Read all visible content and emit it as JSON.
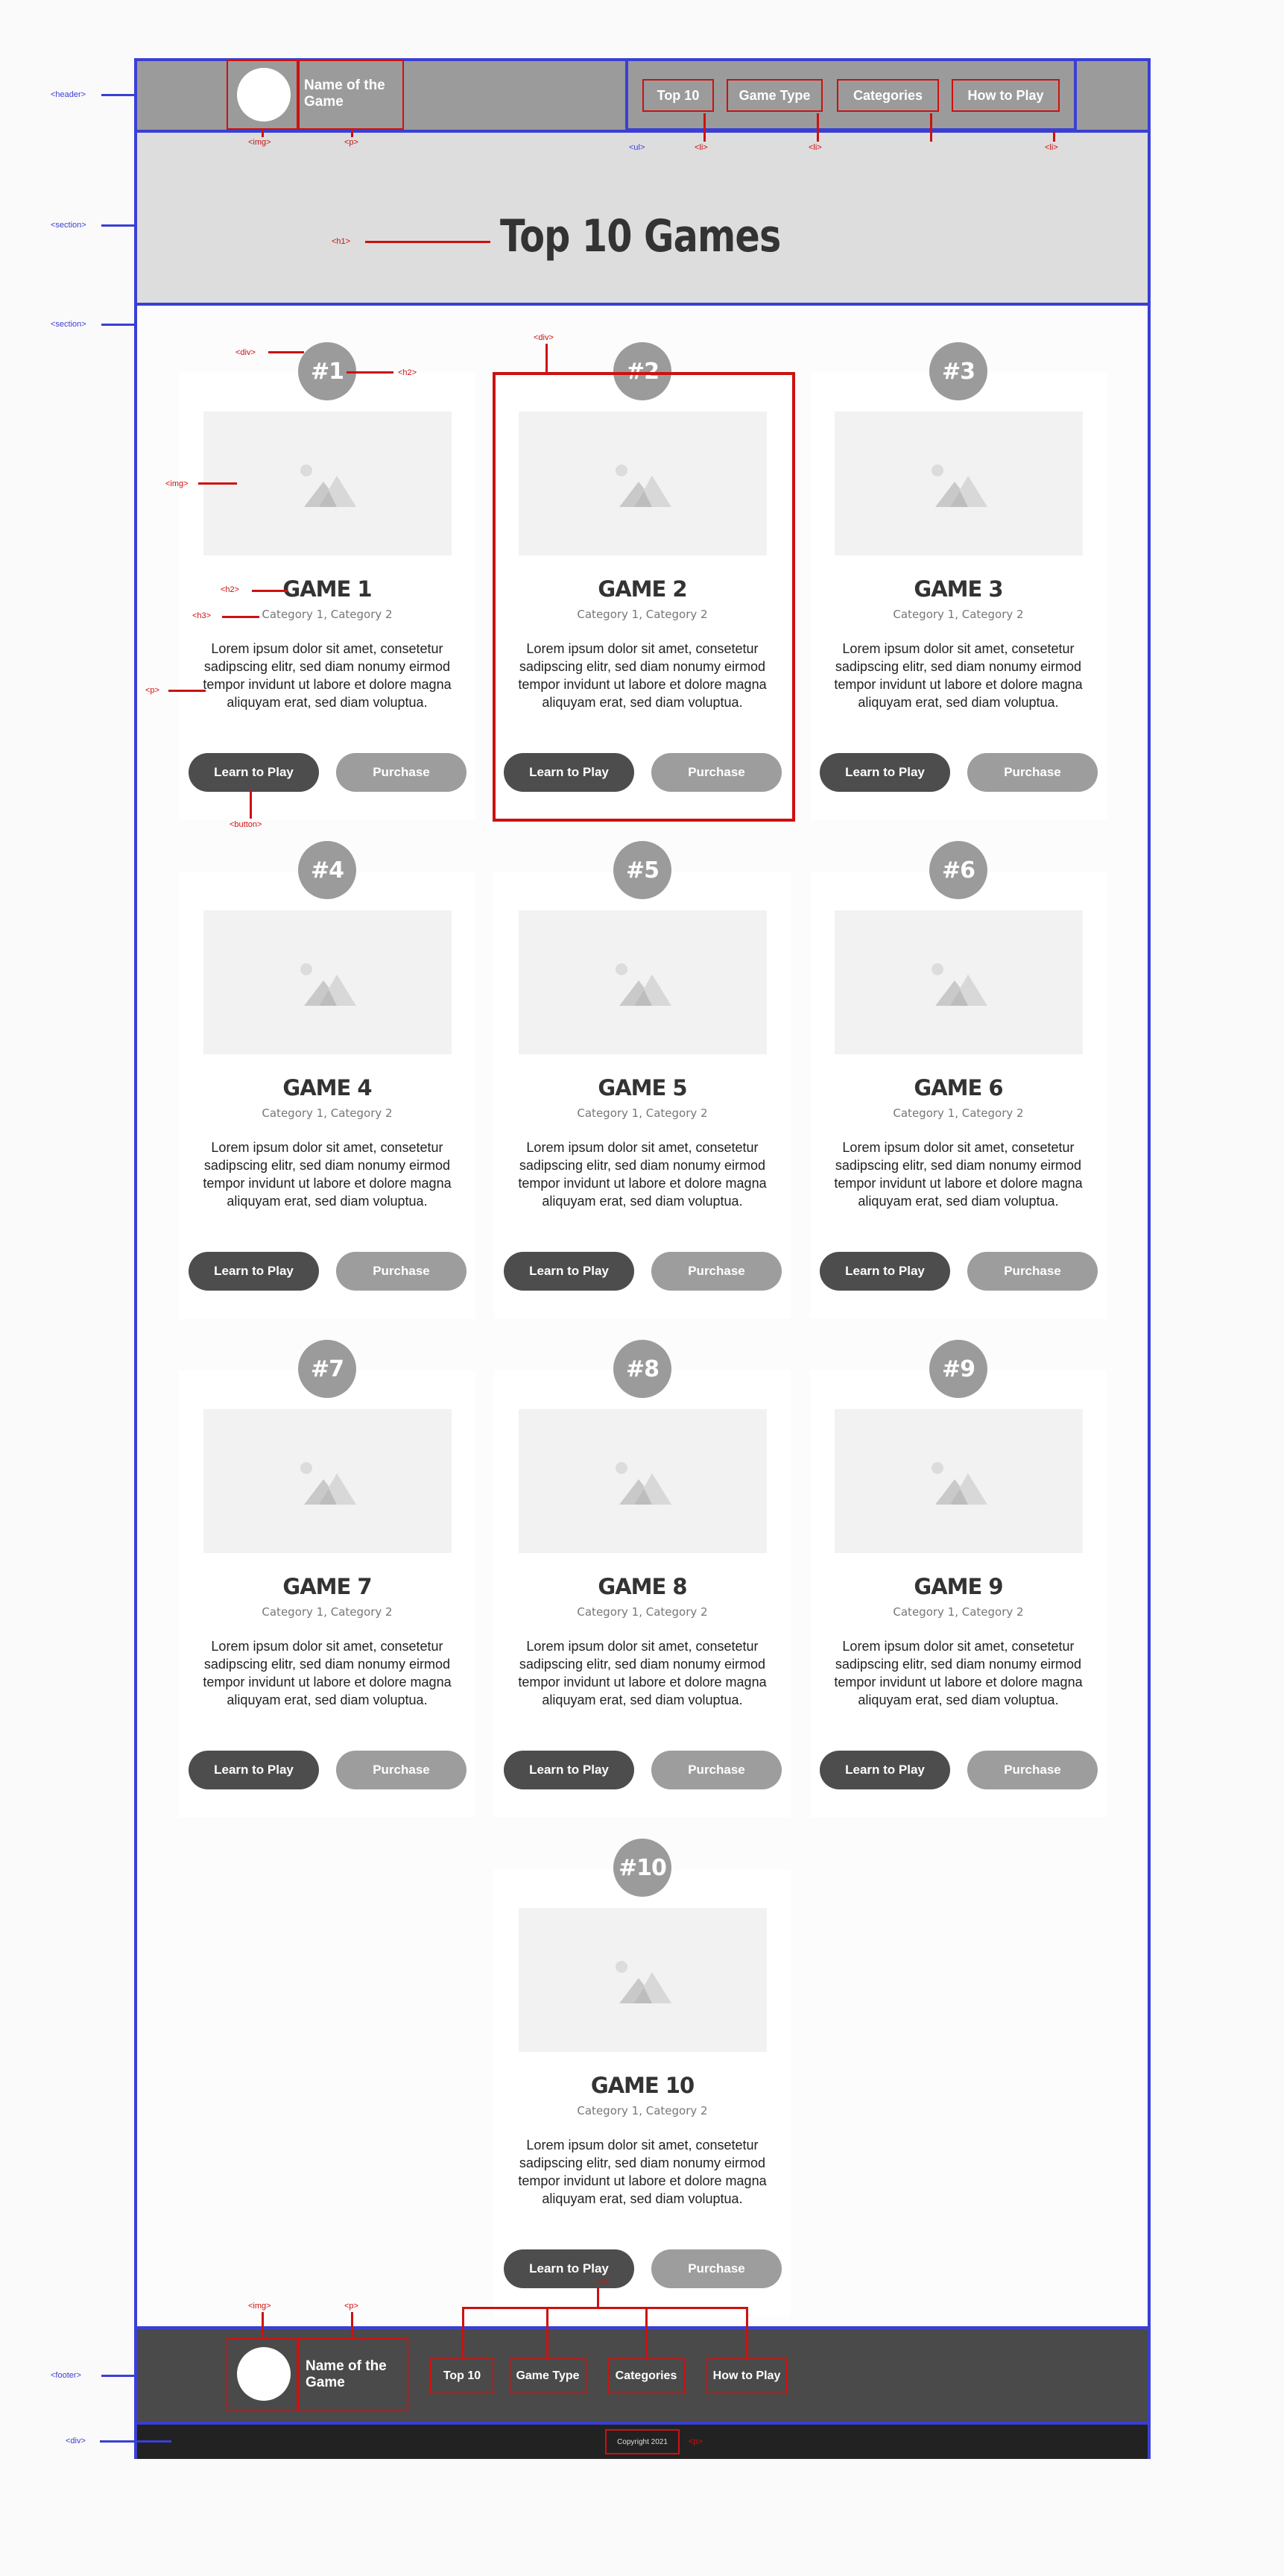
{
  "header": {
    "brand": "Name of the Game",
    "nav": [
      "Top 10",
      "Game Type",
      "Categories",
      "How to Play"
    ]
  },
  "hero": {
    "title": "Top 10 Games"
  },
  "games": [
    {
      "rank": "#1",
      "title": "GAME 1",
      "categories": "Category 1, Category 2"
    },
    {
      "rank": "#2",
      "title": "GAME 2",
      "categories": "Category 1, Category 2"
    },
    {
      "rank": "#3",
      "title": "GAME 3",
      "categories": "Category 1, Category 2"
    },
    {
      "rank": "#4",
      "title": "GAME 4",
      "categories": "Category 1, Category 2"
    },
    {
      "rank": "#5",
      "title": "GAME 5",
      "categories": "Category 1, Category 2"
    },
    {
      "rank": "#6",
      "title": "GAME 6",
      "categories": "Category 1, Category 2"
    },
    {
      "rank": "#7",
      "title": "GAME 7",
      "categories": "Category 1, Category 2"
    },
    {
      "rank": "#8",
      "title": "GAME 8",
      "categories": "Category 1, Category 2"
    },
    {
      "rank": "#9",
      "title": "GAME 9",
      "categories": "Category 1, Category 2"
    },
    {
      "rank": "#10",
      "title": "GAME 10",
      "categories": "Category 1, Category 2"
    }
  ],
  "card_text": {
    "description": "Lorem ipsum dolor sit amet, consetetur sadipscing elitr, sed diam nonumy eirmod tempor invidunt ut labore et dolore magna aliquyam erat, sed diam voluptua.",
    "play_label": "Learn to Play",
    "purchase_label": "Purchase"
  },
  "footer": {
    "brand": "Name of the Game",
    "nav": [
      "Top 10",
      "Game Type",
      "Categories",
      "How to Play"
    ],
    "copyright": "Copyright 2021"
  },
  "annotations": {
    "header": "<header>",
    "section": "<section>",
    "footer": "<footer>",
    "div": "<div>",
    "img": "<img>",
    "p": "<p>",
    "ul": "<ul>",
    "li": "<li>",
    "h1": "<h1>",
    "h2": "<h2>",
    "h3": "<h3>",
    "button": "<button>"
  },
  "colors": {
    "annotation_blue": "#3a3fd4",
    "annotation_red": "#cc1111",
    "header_bg": "#9b9b9b",
    "hero_bg": "#dddddd",
    "footer_bg": "#4a4a4a",
    "copy_bg": "#222222",
    "play_button": "#4d4d4d",
    "purchase_button": "#9d9d9d"
  }
}
